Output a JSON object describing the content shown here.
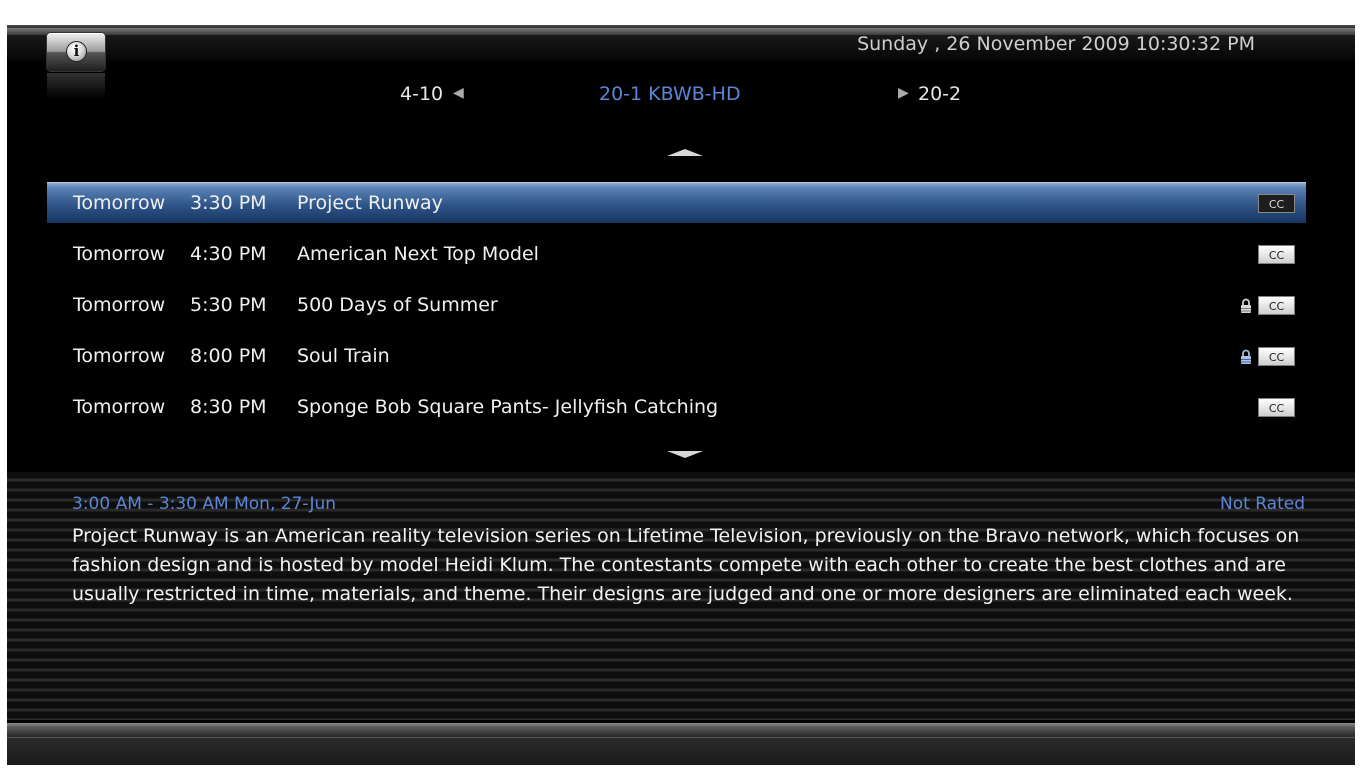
{
  "header": {
    "info_icon": "info-icon",
    "datetime": "Sunday , 26 November 2009 10:30:32 PM"
  },
  "channel_nav": {
    "prev_channel": "4-10",
    "current_channel": "20-1 KBWB-HD",
    "next_channel": "20-2",
    "prev_icon": "triangle-left-icon",
    "next_icon": "triangle-right-icon"
  },
  "programs": [
    {
      "day": "Tomorrow",
      "time": "3:30 PM",
      "title": "Project Runway",
      "cc": "CC",
      "locked": false,
      "selected": true
    },
    {
      "day": "Tomorrow",
      "time": "4:30 PM",
      "title": "American Next Top Model",
      "cc": "CC",
      "locked": false,
      "selected": false
    },
    {
      "day": "Tomorrow",
      "time": "5:30 PM",
      "title": "500 Days of Summer",
      "cc": "CC",
      "locked": true,
      "selected": false
    },
    {
      "day": "Tomorrow",
      "time": "8:00 PM",
      "title": "Soul Train",
      "cc": "CC",
      "locked": true,
      "selected": false
    },
    {
      "day": "Tomorrow",
      "time": "8:30 PM",
      "title": "Sponge Bob Square Pants- Jellyfish Catching",
      "cc": "CC",
      "locked": false,
      "selected": false
    }
  ],
  "details": {
    "time_range": "3:00 AM - 3:30 AM Mon, 27-Jun",
    "rating": "Not Rated",
    "description": "Project Runway is an American reality television series on Lifetime Television, previously on the Bravo network, which focuses on fashion design and is hosted by model Heidi Klum. The contestants compete with each other to create the best clothes and are usually restricted in time, materials, and theme. Their designs are judged and one or more designers are eliminated each week."
  },
  "colors": {
    "accent": "#5b86d6",
    "selected_row": "#2f5488",
    "background": "#000000"
  }
}
